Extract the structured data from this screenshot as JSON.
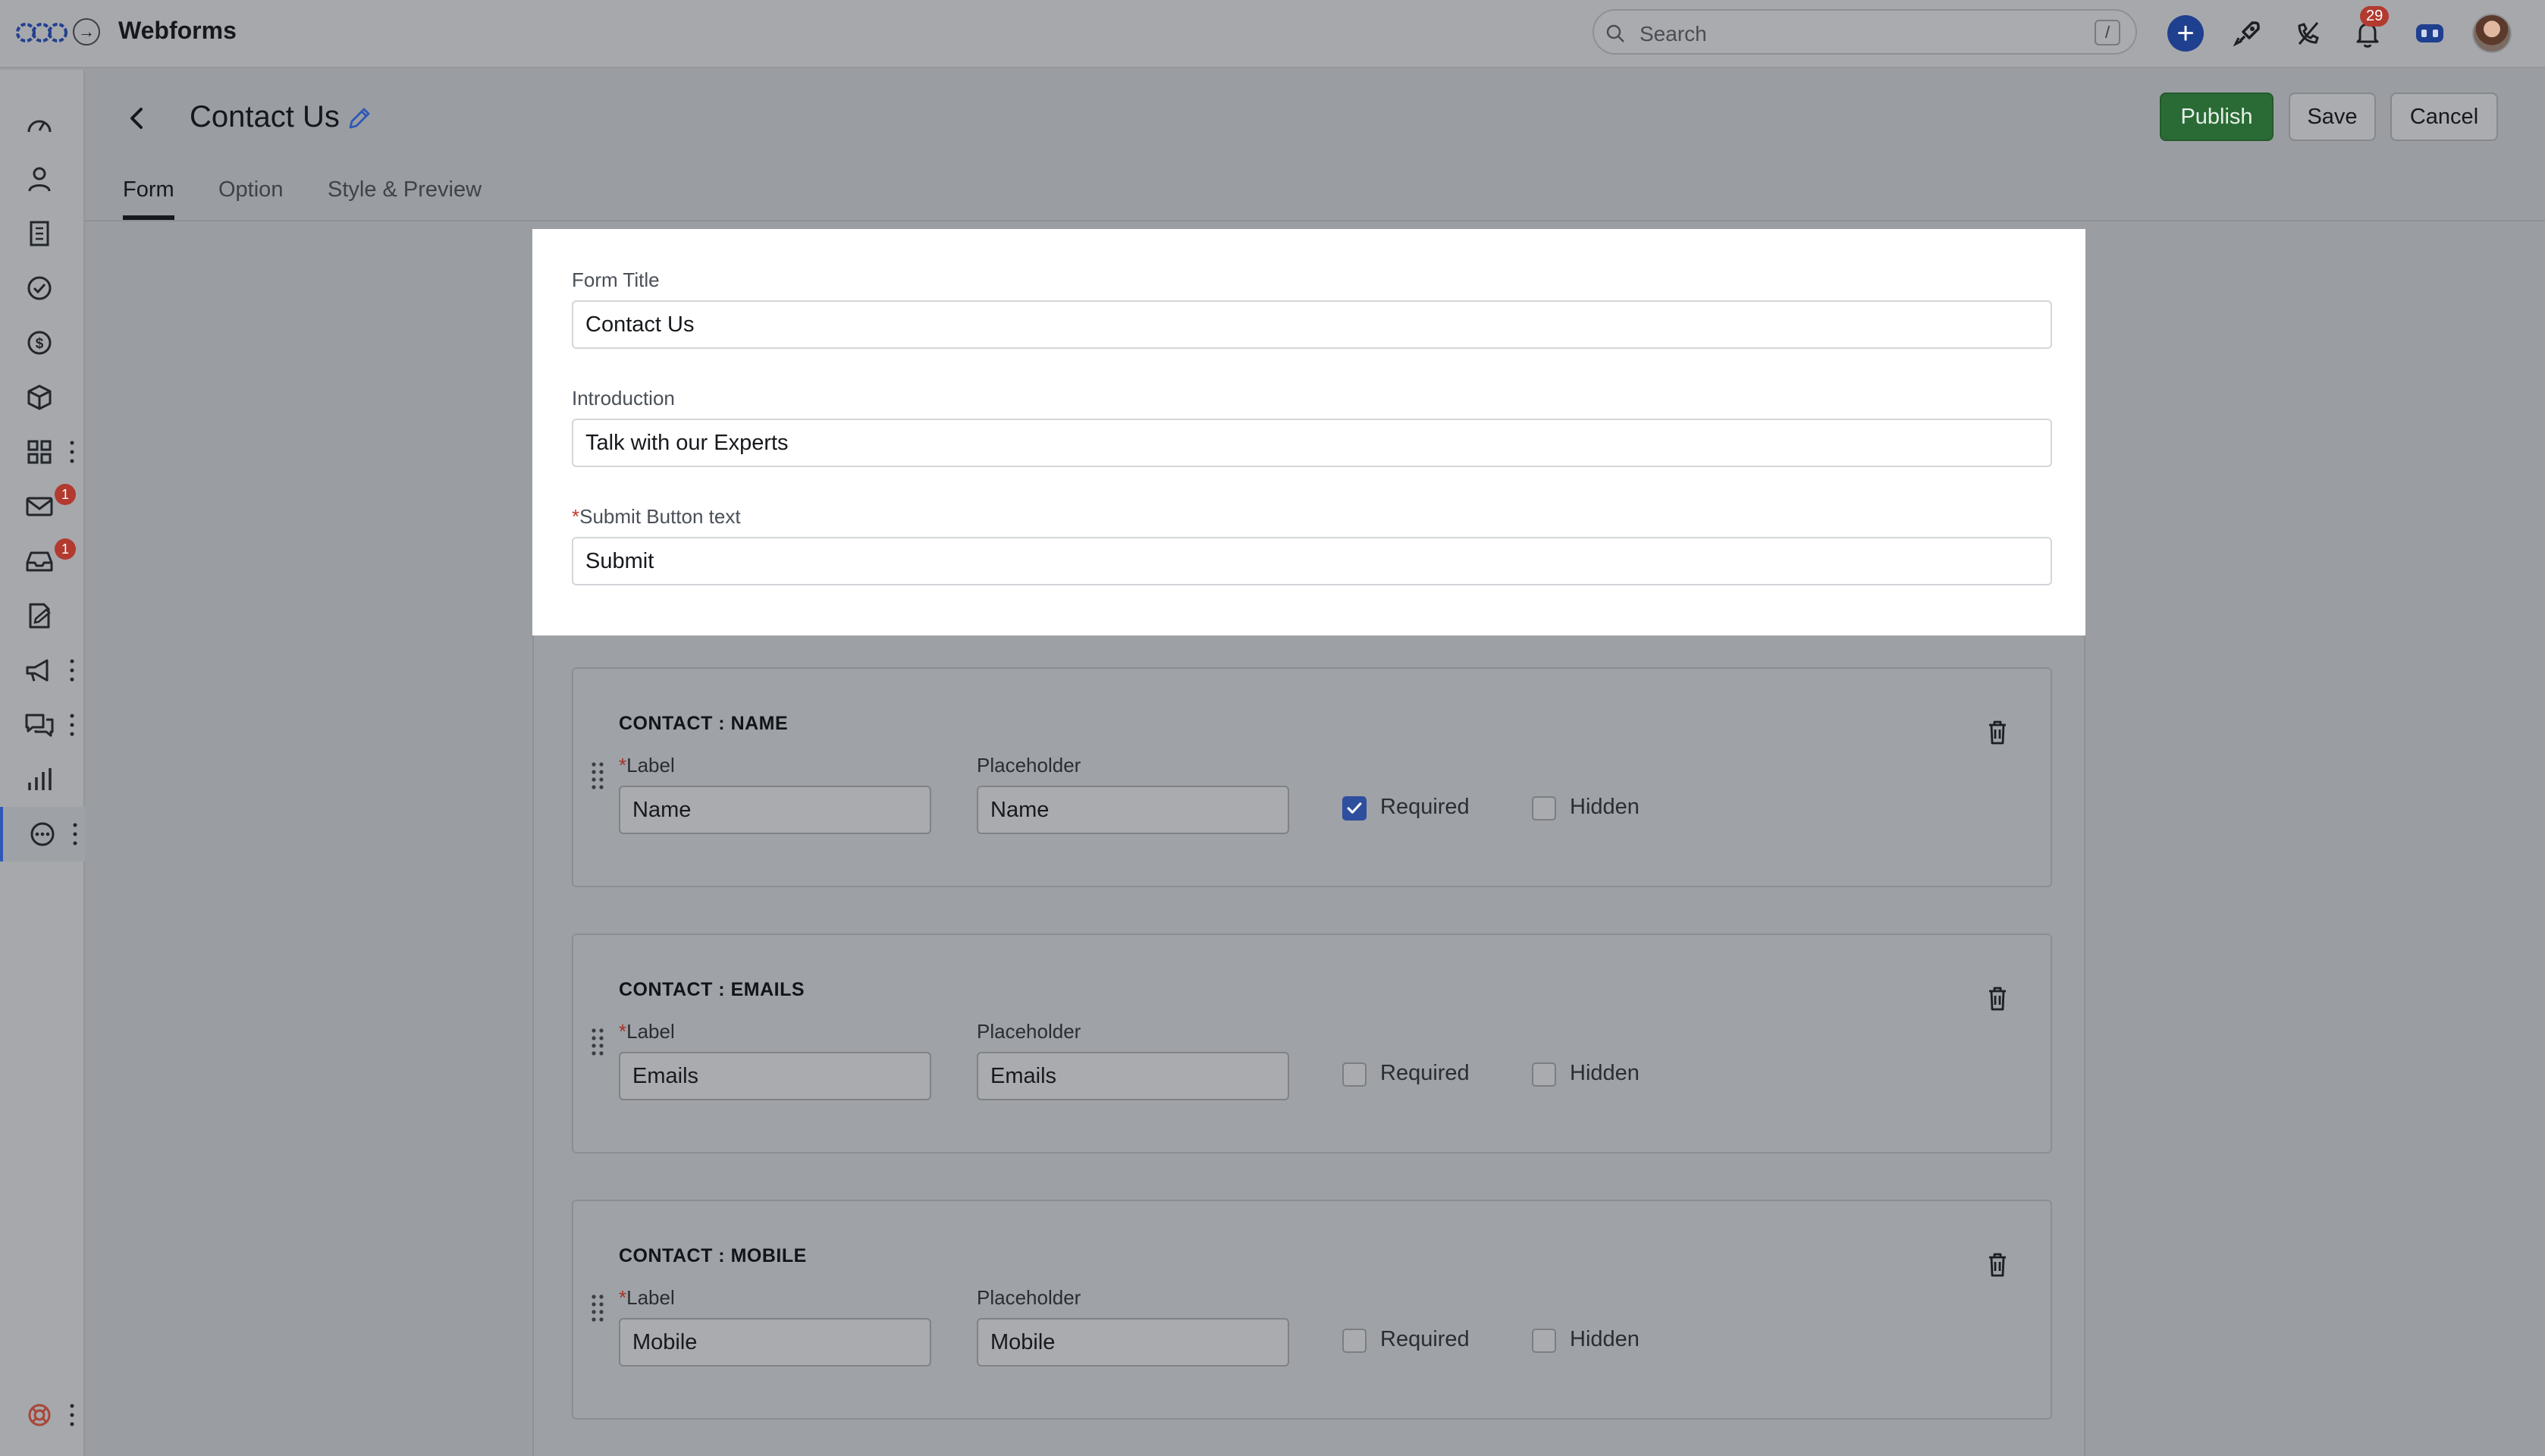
{
  "app": {
    "title": "Webforms"
  },
  "search": {
    "placeholder": "Search",
    "shortcut": "/"
  },
  "notifications": {
    "count": "29"
  },
  "sidebar": {
    "items": [
      {
        "icon": "dashboard-icon"
      },
      {
        "icon": "person-icon"
      },
      {
        "icon": "building-icon"
      },
      {
        "icon": "check-circle-icon"
      },
      {
        "icon": "dollar-icon"
      },
      {
        "icon": "box-icon"
      },
      {
        "icon": "apps-icon",
        "more": true
      },
      {
        "icon": "mail-icon",
        "badge": "1"
      },
      {
        "icon": "inbox-icon",
        "badge": "1"
      },
      {
        "icon": "document-icon"
      },
      {
        "icon": "megaphone-icon",
        "more": true
      },
      {
        "icon": "chat-icon",
        "more": true
      },
      {
        "icon": "bar-chart-icon"
      },
      {
        "icon": "more-circle-icon",
        "more": true,
        "active": true
      }
    ],
    "footer_icon": "help-lifebuoy-icon"
  },
  "header": {
    "title": "Contact Us",
    "buttons": {
      "publish": "Publish",
      "save": "Save",
      "cancel": "Cancel"
    }
  },
  "tabs": [
    {
      "label": "Form",
      "active": true
    },
    {
      "label": "Option",
      "active": false
    },
    {
      "label": "Style & Preview",
      "active": false
    }
  ],
  "form": {
    "title_label": "Form Title",
    "title_value": "Contact Us",
    "intro_label": "Introduction",
    "intro_value": "Talk with our Experts",
    "submit_required_mark": "*",
    "submit_label": "Submit Button text",
    "submit_value": "Submit"
  },
  "fields": [
    {
      "title": "CONTACT : NAME",
      "label_caption": "Label",
      "required_mark": "*",
      "placeholder_caption": "Placeholder",
      "label_value": "Name",
      "placeholder_value": "Name",
      "required_text": "Required",
      "hidden_text": "Hidden",
      "required": true,
      "hidden": false
    },
    {
      "title": "CONTACT : EMAILS",
      "label_caption": "Label",
      "required_mark": "*",
      "placeholder_caption": "Placeholder",
      "label_value": "Emails",
      "placeholder_value": "Emails",
      "required_text": "Required",
      "hidden_text": "Hidden",
      "required": false,
      "hidden": false
    },
    {
      "title": "CONTACT : MOBILE",
      "label_caption": "Label",
      "required_mark": "*",
      "placeholder_caption": "Placeholder",
      "label_value": "Mobile",
      "placeholder_value": "Mobile",
      "required_text": "Required",
      "hidden_text": "Hidden",
      "required": false,
      "hidden": false
    }
  ],
  "colors": {
    "accent": "#2e4f9e",
    "publish": "#2a6b35",
    "badge": "#b23a2f"
  }
}
